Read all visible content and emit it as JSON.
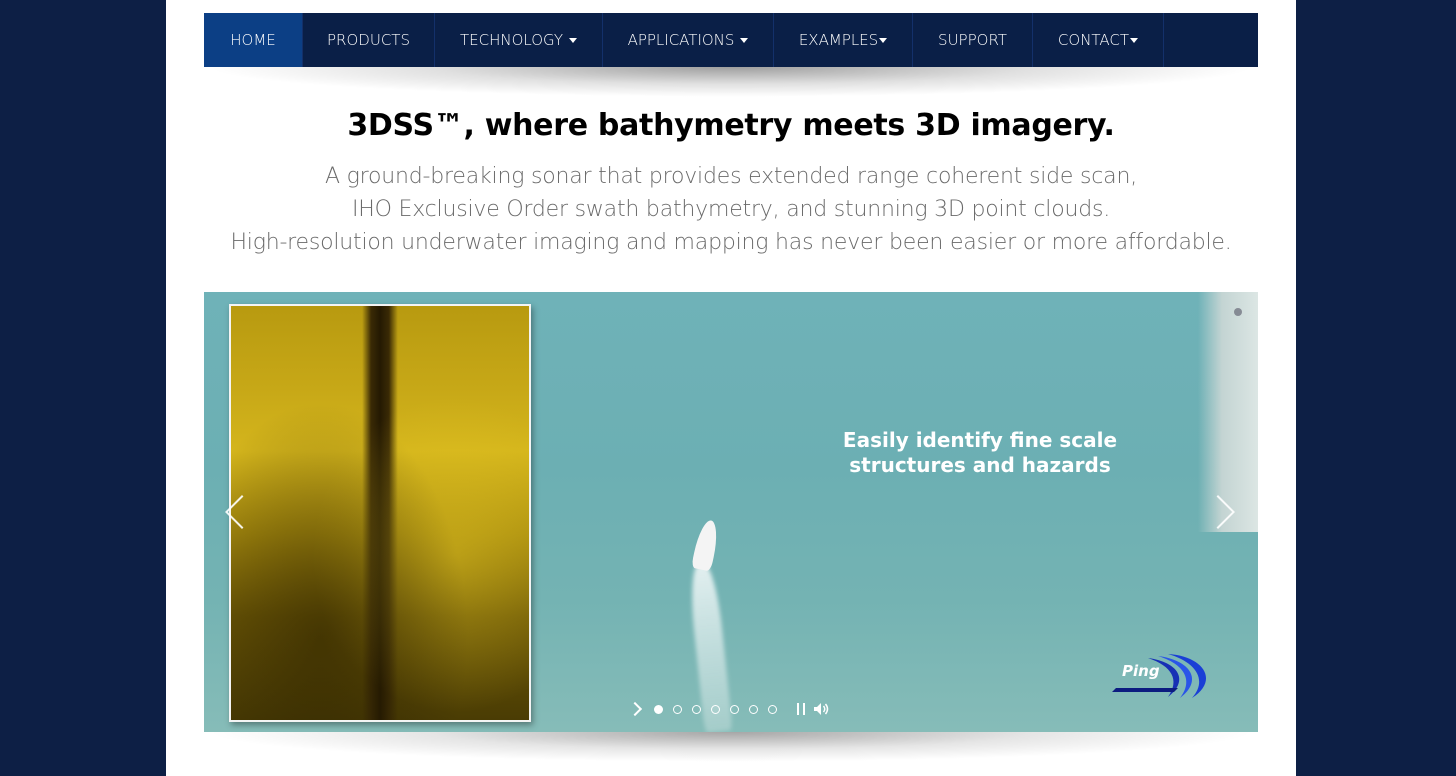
{
  "nav": {
    "items": [
      {
        "label": "HOME",
        "dropdown": false,
        "active": true
      },
      {
        "label": "PRODUCTS",
        "dropdown": false,
        "active": false
      },
      {
        "label": "TECHNOLOGY",
        "dropdown": true,
        "active": false
      },
      {
        "label": "APPLICATIONS",
        "dropdown": true,
        "active": false
      },
      {
        "label": "EXAMPLES",
        "dropdown": true,
        "active": false
      },
      {
        "label": "SUPPORT",
        "dropdown": false,
        "active": false
      },
      {
        "label": "CONTACT",
        "dropdown": true,
        "active": false
      }
    ]
  },
  "hero": {
    "headline": "3DSS™, where bathymetry meets 3D imagery.",
    "lines": [
      "A ground-breaking sonar that provides extended range coherent side scan,",
      "IHO Exclusive Order swath bathymetry, and stunning 3D point clouds.",
      "High-resolution underwater imaging and mapping has never been easier or more affordable."
    ]
  },
  "slider": {
    "caption_line1": "Easily identify fine scale",
    "caption_line2": "structures and hazards",
    "logo_text": "Ping",
    "slide_count": 7,
    "active_slide": 1
  },
  "colors": {
    "background": "#0d1f45",
    "nav_bg": "#0a1f47",
    "nav_active": "#0c3f85"
  },
  "icons": [
    "chevron-left-icon",
    "chevron-right-icon",
    "play-icon",
    "pause-icon",
    "volume-icon",
    "caret-down-icon"
  ]
}
